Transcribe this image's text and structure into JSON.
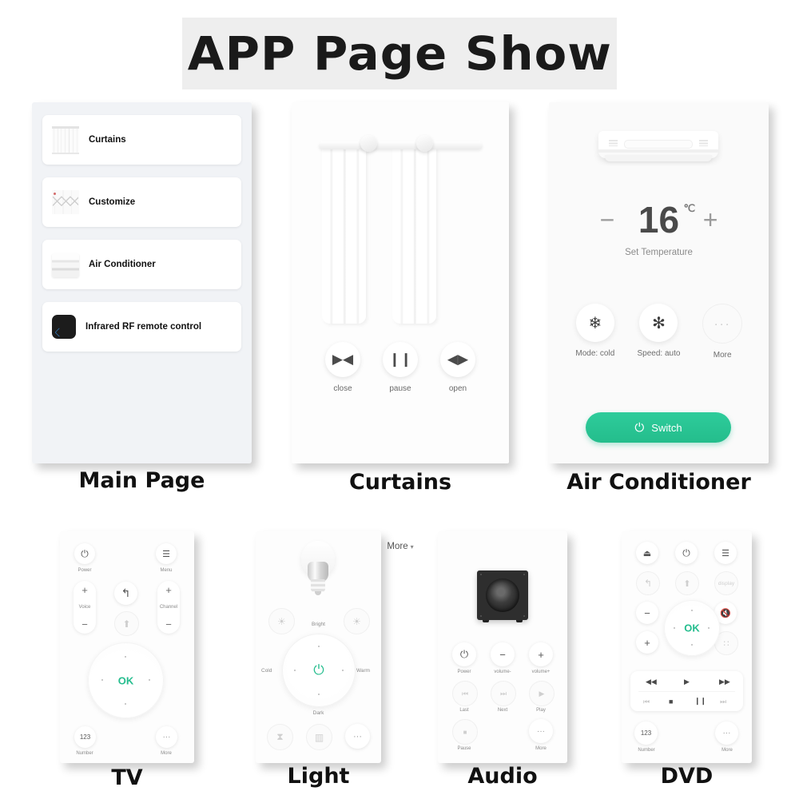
{
  "title": "APP Page Show",
  "captions": {
    "main_page": "Main Page",
    "curtains": "Curtains",
    "air_conditioner": "Air Conditioner",
    "tv": "TV",
    "light": "Light",
    "audio": "Audio",
    "dvd": "DVD"
  },
  "colors": {
    "accent_green": "#25bd8e",
    "switch_button": "#2ecc9b",
    "panel_bg": "#fdfdfd",
    "list_bg": "#f1f3f6",
    "title_band": "#eeeeee"
  },
  "main_page": {
    "items": [
      {
        "label": "Curtains",
        "icon": "curtain-icon"
      },
      {
        "label": "Customize",
        "icon": "customize-icon"
      },
      {
        "label": "Air Conditioner",
        "icon": "air-conditioner-icon"
      },
      {
        "label": "Infrared RF remote control",
        "icon": "ir-hub-icon"
      }
    ]
  },
  "curtains_page": {
    "controls": [
      {
        "label": "close",
        "icon": "close-curtain-icon",
        "glyph": "▶◀"
      },
      {
        "label": "pause",
        "icon": "pause-icon",
        "glyph": "❙❙"
      },
      {
        "label": "open",
        "icon": "open-curtain-icon",
        "glyph": "◀▶"
      }
    ],
    "more_label": "More",
    "more_caret": "▾"
  },
  "ac_page": {
    "minus": "−",
    "plus": "+",
    "temperature": "16",
    "unit": "℃",
    "set_label": "Set Temperature",
    "modes": [
      {
        "label": "Mode: cold",
        "icon": "snowflake-icon",
        "glyph": "❄"
      },
      {
        "label": "Speed: auto",
        "icon": "fan-auto-icon",
        "glyph": "✻"
      },
      {
        "label": "More",
        "icon": "more-dots-icon",
        "glyph": "···"
      }
    ],
    "switch_label": "Switch",
    "switch_icon": "power-icon",
    "switch_glyph": "⏻"
  },
  "tv_page": {
    "power": {
      "label": "Power",
      "glyph": "⏻",
      "icon": "power-icon"
    },
    "menu": {
      "label": "Menu",
      "glyph": "☰",
      "icon": "menu-icon"
    },
    "voice": {
      "label": "Voice",
      "plus": "+",
      "minus": "−",
      "icon": "voice-stepper"
    },
    "channel": {
      "label": "Channel",
      "plus": "+",
      "minus": "−",
      "icon": "channel-stepper"
    },
    "back": {
      "glyph": "↰",
      "icon": "back-arrow-icon"
    },
    "home": {
      "glyph": "⬆",
      "icon": "home-icon"
    },
    "ok": "OK",
    "number": {
      "label": "Number",
      "glyph": "123",
      "icon": "number-pad-icon"
    },
    "more": {
      "label": "More",
      "glyph": "···",
      "icon": "more-dots-icon"
    }
  },
  "light_page": {
    "dim_icon": "dim-brightness-icon",
    "bright_icon": "full-brightness-icon",
    "dim_glyph": "☀",
    "bright_glyph": "☀",
    "power_glyph": "⏻",
    "dial_labels": {
      "top": "Bright",
      "bottom": "Dark",
      "left": "Cold",
      "right": "Warm"
    },
    "bottom": [
      {
        "icon": "timer-icon",
        "glyph": "⧗"
      },
      {
        "icon": "scene-icon",
        "glyph": "▥"
      },
      {
        "icon": "more-dots-icon",
        "glyph": "···"
      }
    ]
  },
  "audio_page": {
    "buttons": [
      {
        "label": "Power",
        "glyph": "⏻",
        "icon": "power-icon",
        "dim": false
      },
      {
        "label": "volume-",
        "glyph": "−",
        "icon": "volume-down-icon",
        "dim": false
      },
      {
        "label": "volume+",
        "glyph": "+",
        "icon": "volume-up-icon",
        "dim": false
      },
      {
        "label": "Last",
        "glyph": "⏮",
        "icon": "previous-track-icon",
        "dim": true
      },
      {
        "label": "Next",
        "glyph": "⏭",
        "icon": "next-track-icon",
        "dim": true
      },
      {
        "label": "Play",
        "glyph": "▶",
        "icon": "play-icon",
        "dim": true
      },
      {
        "label": "Pause",
        "glyph": "■",
        "icon": "stop-icon",
        "dim": true
      },
      {
        "label": "More",
        "glyph": "···",
        "icon": "more-dots-icon",
        "dim": true
      }
    ]
  },
  "dvd_page": {
    "eject": {
      "glyph": "⏏",
      "icon": "eject-icon"
    },
    "power": {
      "glyph": "⏻",
      "icon": "power-icon"
    },
    "menu": {
      "glyph": "☰",
      "icon": "menu-icon"
    },
    "back": {
      "glyph": "↰",
      "icon": "back-arrow-icon"
    },
    "home": {
      "glyph": "⬆",
      "icon": "home-icon"
    },
    "display": {
      "glyph": "display",
      "icon": "display-icon"
    },
    "minus": {
      "glyph": "−",
      "icon": "volume-down-icon"
    },
    "plus": {
      "glyph": "+",
      "icon": "volume-up-icon"
    },
    "mute": {
      "glyph": "🔇",
      "icon": "mute-icon"
    },
    "grid": {
      "glyph": "∷",
      "icon": "grid-icon"
    },
    "ok": "OK",
    "transport": [
      {
        "glyph": "◀◀",
        "icon": "rewind-icon",
        "dim": false
      },
      {
        "glyph": "▶",
        "icon": "play-icon",
        "dim": false
      },
      {
        "glyph": "▶▶",
        "icon": "fast-forward-icon",
        "dim": false
      },
      {
        "glyph": "⏮",
        "icon": "previous-track-icon",
        "dim": true
      },
      {
        "glyph": "■",
        "icon": "stop-icon",
        "dim": false
      },
      {
        "glyph": "❙❙",
        "icon": "pause-icon",
        "dim": false
      },
      {
        "glyph": "⏭",
        "icon": "next-track-icon",
        "dim": true
      }
    ],
    "number": {
      "label": "Number",
      "glyph": "123",
      "icon": "number-pad-icon"
    },
    "more": {
      "label": "More",
      "glyph": "···",
      "icon": "more-dots-icon"
    }
  }
}
